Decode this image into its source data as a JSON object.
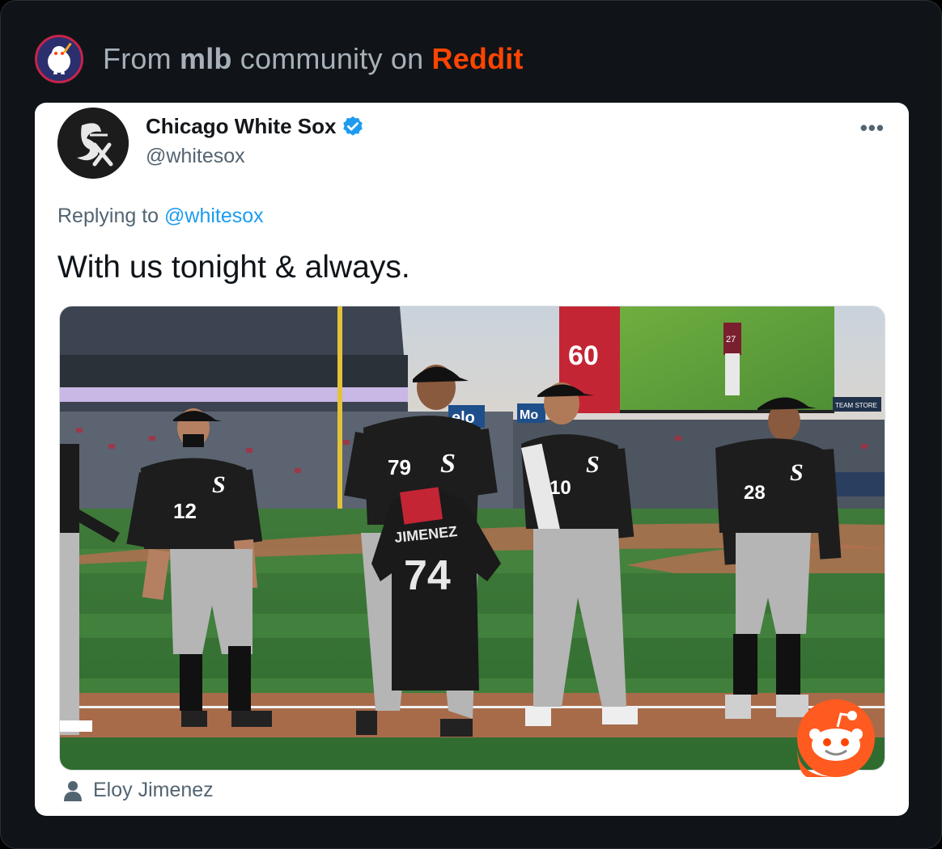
{
  "header": {
    "prefix": "From ",
    "community": "mlb",
    "middle": " community on ",
    "platform": "Reddit",
    "avatar_icon": "snoo-icon"
  },
  "tweet": {
    "display_name": "Chicago White Sox",
    "handle": "@whitesox",
    "verified_icon": "verified-badge-icon",
    "more_icon": "more-options-icon",
    "more_label": "•••",
    "replying_prefix": "Replying to ",
    "replying_to": "@whitesox",
    "text": "With us tonight & always.",
    "photo_caption": "Eloy Jimenez",
    "caption_icon": "person-icon"
  },
  "photo": {
    "alt_subject": "White Sox players lined up on the field, one holding a Jimenez 74 jersey",
    "jersey_numbers": [
      "12",
      "79",
      "10",
      "28"
    ],
    "held_jersey_name": "JIMENEZ",
    "held_jersey_number": "74",
    "scoreboard_number": "60",
    "scoreboard_player_number": "27",
    "sign_partial": "elo",
    "sign_partial_2": "Mo",
    "team_store": "TEAM STORE"
  },
  "colors": {
    "reddit_orange": "#ff4500",
    "twitter_blue": "#1d9bf0",
    "frame_bg": "#101418"
  }
}
